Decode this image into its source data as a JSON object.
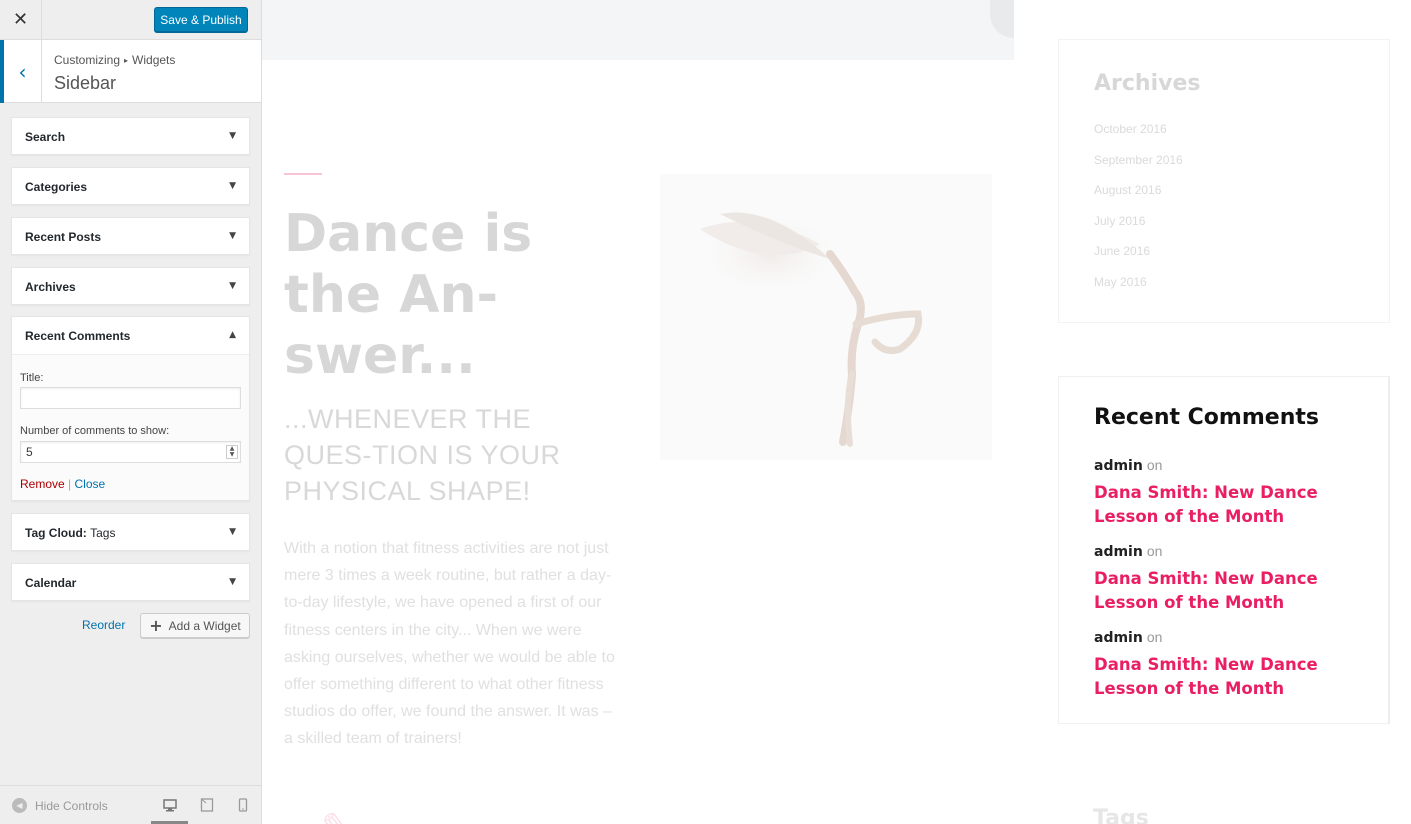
{
  "customizer": {
    "close_icon": "close-icon",
    "publish_label": "Save & Publish",
    "breadcrumb": {
      "root": "Customizing",
      "separator": "▸",
      "section": "Widgets"
    },
    "section_title": "Sidebar",
    "widgets": [
      {
        "title": "Search"
      },
      {
        "title": "Categories"
      },
      {
        "title": "Recent Posts"
      },
      {
        "title": "Archives"
      }
    ],
    "open_widget": {
      "title": "Recent Comments",
      "title_field_label": "Title:",
      "title_field_value": "",
      "number_field_label": "Number of comments to show:",
      "number_field_value": "5",
      "remove_label": "Remove",
      "divider": "|",
      "close_label": "Close"
    },
    "widgets_after": [
      {
        "title": "Tag Cloud:",
        "subtitle": "Tags"
      },
      {
        "title": "Calendar"
      }
    ],
    "reorder_label": "Reorder",
    "add_widget_label": "Add a Widget",
    "hide_controls_label": "Hide Controls",
    "colors": {
      "primary": "#0085ba",
      "link": "#0073aa",
      "remove": "#a00000"
    }
  },
  "preview": {
    "hero": {
      "title": "Dance is the An-swer...",
      "subtitle": "...WHENEVER THE QUES-TION IS YOUR PHYSICAL SHAPE!",
      "body": "With a notion that fitness activities are not just mere 3 times a week routine, but rather a day-to-day lifestyle, we have opened a first of our fitness centers in the city... When we were asking ourselves, whether we would be able to offer something different to what other fitness studios do offer, we found the answer. It was – a skilled team of trainers!"
    },
    "archives": {
      "heading": "Archives",
      "items": [
        "October 2016",
        "September 2016",
        "August 2016",
        "July 2016",
        "June 2016",
        "May 2016"
      ]
    },
    "recent_comments": {
      "heading": "Recent Comments",
      "items": [
        {
          "author": "admin",
          "on": "on",
          "post": "Dana Smith: New Dance Lesson of the Month"
        },
        {
          "author": "admin",
          "on": "on",
          "post": "Dana Smith: New Dance Lesson of the Month"
        },
        {
          "author": "admin",
          "on": "on",
          "post": "Dana Smith: New Dance Lesson of the Month"
        }
      ],
      "link_color": "#e91e63"
    },
    "tags_heading": "Tags"
  }
}
